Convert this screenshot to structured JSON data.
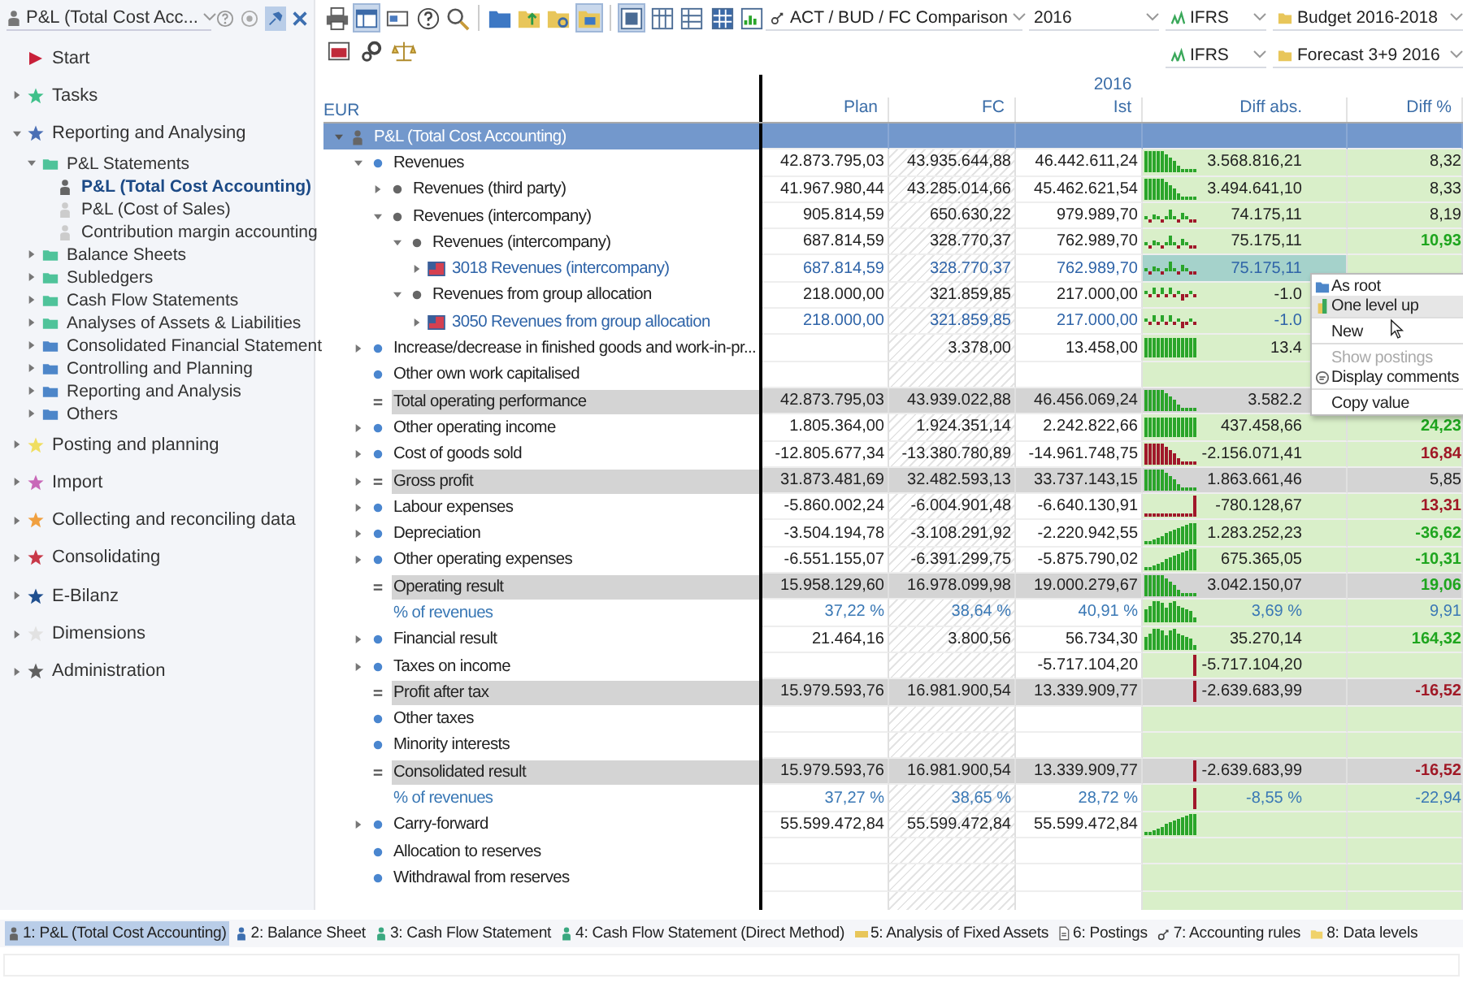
{
  "sidebar": {
    "selector": {
      "value": "P&L (Total Cost Acc..."
    },
    "header_buttons": [
      {
        "kind": "help",
        "selected": false
      },
      {
        "kind": "eye",
        "selected": false
      },
      {
        "kind": "pin",
        "selected": true
      },
      {
        "kind": "close",
        "selected": false
      }
    ],
    "items": [
      {
        "label": "Start",
        "kind": "start",
        "color": "#c8203a"
      },
      {
        "label": "Tasks",
        "kind": "group",
        "color": "#3fc08a",
        "expanded": false
      },
      {
        "label": "Reporting and Analysing",
        "kind": "group",
        "color": "#4a6fb5",
        "expanded": true,
        "children": [
          {
            "label": "P&L Statements",
            "kind": "folder",
            "color": "#4fc39a",
            "expanded": true,
            "children": [
              {
                "label": "P&L (Total Cost Accounting)",
                "kind": "report",
                "selected": true
              },
              {
                "label": "P&L (Cost of Sales)",
                "kind": "report",
                "selected": false
              },
              {
                "label": "Contribution margin accounting",
                "kind": "report",
                "selected": false
              }
            ]
          },
          {
            "label": "Balance Sheets",
            "kind": "folder",
            "color": "#4fc39a",
            "expanded": false
          },
          {
            "label": "Subledgers",
            "kind": "folder",
            "color": "#4fc39a",
            "expanded": false
          },
          {
            "label": "Cash Flow Statements",
            "kind": "folder",
            "color": "#4fc39a",
            "expanded": false
          },
          {
            "label": "Analyses of Assets & Liabilities",
            "kind": "folder",
            "color": "#4fc39a",
            "expanded": false
          },
          {
            "label": "Consolidated Financial Statement",
            "kind": "folder",
            "color": "#4d86c9",
            "expanded": false
          },
          {
            "label": "Controlling and Planning",
            "kind": "folder",
            "color": "#4d86c9",
            "expanded": false
          },
          {
            "label": "Reporting and Analysis",
            "kind": "folder",
            "color": "#4d86c9",
            "expanded": false
          },
          {
            "label": "Others",
            "kind": "folder",
            "color": "#4d86c9",
            "expanded": false
          }
        ]
      },
      {
        "label": "Posting and planning",
        "kind": "group",
        "color": "#f0de60",
        "expanded": false
      },
      {
        "label": "Import",
        "kind": "group",
        "color": "#c868b8",
        "expanded": false
      },
      {
        "label": "Collecting and reconciling data",
        "kind": "group",
        "color": "#f0a040",
        "expanded": false
      },
      {
        "label": "Consolidating",
        "kind": "group",
        "color": "#c83848",
        "expanded": false
      },
      {
        "label": "E-Bilanz",
        "kind": "group",
        "color": "#1f4f8f",
        "expanded": false
      },
      {
        "label": "Dimensions",
        "kind": "group",
        "color": "#e2e2e2",
        "expanded": false
      },
      {
        "label": "Administration",
        "kind": "group",
        "color": "#606060",
        "expanded": false
      }
    ]
  },
  "toolbar": {
    "row_1": [
      {
        "kind": "print",
        "selected": false
      },
      {
        "kind": "layout",
        "selected": true
      },
      {
        "kind": "card",
        "selected": false
      },
      {
        "kind": "help",
        "selected": false
      },
      {
        "kind": "search",
        "selected": false
      },
      {
        "kind": "separator"
      },
      {
        "kind": "folder-open",
        "selected": false
      },
      {
        "kind": "folder-up",
        "selected": false
      },
      {
        "kind": "folder-gear",
        "selected": false
      },
      {
        "kind": "folder-view",
        "selected": true
      },
      {
        "kind": "separator"
      },
      {
        "kind": "view-frame",
        "selected": true
      },
      {
        "kind": "view-columns",
        "selected": false
      },
      {
        "kind": "view-rows",
        "selected": false
      },
      {
        "kind": "view-grid",
        "selected": false
      },
      {
        "kind": "view-chart",
        "selected": false
      }
    ],
    "row_2": [
      {
        "kind": "window",
        "selected": false
      },
      {
        "kind": "gears",
        "selected": false
      },
      {
        "kind": "scale",
        "selected": false
      }
    ],
    "selectors_row_1": [
      {
        "kind": "link",
        "value": "ACT / BUD / FC Comparison"
      },
      {
        "kind": "plain",
        "value": "2016"
      },
      {
        "kind": "tree",
        "value": "IFRS"
      },
      {
        "kind": "folder",
        "value": "Budget 2016-2018"
      }
    ],
    "selectors_row_2": [
      {
        "kind": "tree",
        "value": "IFRS"
      },
      {
        "kind": "folder",
        "value": "Forecast 3+9 2016"
      }
    ]
  },
  "table": {
    "group_header": "2016",
    "corner": "EUR",
    "columns": [
      "Plan",
      "FC",
      "Ist",
      "Diff abs.",
      "Diff %"
    ],
    "rows": [
      {
        "kind": "root",
        "label": "P&L (Total Cost Accounting)",
        "expanded": true,
        "selected": false,
        "children": [
          {
            "kind": "item",
            "label": "Revenues",
            "expanded": true,
            "selected": false,
            "plan": "42.873.795,03",
            "fc": "43.935.644,88",
            "ist": "46.442.611,24",
            "diff_abs": "3.568.816,21",
            "diff_pct": {
              "value": "8,32"
            },
            "sparkline": {
              "kind": "falling",
              "color": "#2aa52a"
            },
            "children": [
              {
                "kind": "item",
                "label": "Revenues (third party)",
                "expanded": false,
                "selected": false,
                "plan": "41.967.980,44",
                "fc": "43.285.014,66",
                "ist": "45.462.621,54",
                "diff_abs": "3.494.641,10",
                "diff_pct": {
                  "value": "8,33"
                },
                "sparkline": {
                  "kind": "falling",
                  "color": "#2aa52a"
                }
              },
              {
                "kind": "item",
                "label": "Revenues (intercompany)",
                "expanded": true,
                "selected": false,
                "plan": "905.814,59",
                "fc": "650.630,22",
                "ist": "979.989,70",
                "diff_abs": "74.175,11",
                "diff_pct": {
                  "value": "8,19"
                },
                "sparkline": {
                  "kind": "mixed",
                  "color": "#2aa52a"
                },
                "children": [
                  {
                    "kind": "item",
                    "label": "Revenues (intercompany)",
                    "expanded": true,
                    "selected": false,
                    "plan": "687.814,59",
                    "fc": "328.770,37",
                    "ist": "762.989,70",
                    "diff_abs": "75.175,11",
                    "diff_pct": {
                      "value": "10,93",
                      "color": "#1ea51e"
                    },
                    "sparkline": {
                      "kind": "mixed",
                      "color": "#2aa52a"
                    },
                    "children": [
                      {
                        "kind": "account",
                        "label": "3018 Revenues (intercompany)",
                        "expanded": false,
                        "selected": true,
                        "plan": "687.814,59",
                        "fc": "328.770,37",
                        "ist": "762.989,70",
                        "diff_abs": "75.175,11",
                        "sparkline": {
                          "kind": "mixed",
                          "color": "#2aa52a"
                        }
                      }
                    ]
                  },
                  {
                    "kind": "item",
                    "label": "Revenues from group allocation",
                    "expanded": true,
                    "selected": false,
                    "plan": "218.000,00",
                    "fc": "321.859,85",
                    "ist": "217.000,00",
                    "diff_abs": "-1.0",
                    "sparkline": {
                      "kind": "dips",
                      "color": "#2aa52a"
                    },
                    "children": [
                      {
                        "kind": "account",
                        "label": "3050 Revenues from group allocation",
                        "expanded": false,
                        "selected": false,
                        "plan": "218.000,00",
                        "fc": "321.859,85",
                        "ist": "217.000,00",
                        "diff_abs": "-1.0",
                        "sparkline": {
                          "kind": "dips",
                          "color": "#2aa52a"
                        }
                      }
                    ]
                  }
                ]
              }
            ]
          },
          {
            "kind": "item",
            "label": "Increase/decrease in finished goods and work-in-pr...",
            "expanded": false,
            "selected": false,
            "fc": "3.378,00",
            "ist": "13.458,00",
            "diff_abs": "13.4",
            "sparkline": {
              "kind": "full",
              "color": "#2aa52a"
            }
          },
          {
            "kind": "item",
            "label": "Other own work capitalised",
            "selected": false
          },
          {
            "kind": "sum",
            "label": "Total operating performance",
            "selected": false,
            "plan": "42.873.795,03",
            "fc": "43.939.022,88",
            "ist": "46.456.069,24",
            "diff_abs": "3.582.2",
            "sparkline": {
              "kind": "falling",
              "color": "#2aa52a"
            }
          },
          {
            "kind": "item",
            "label": "Other operating income",
            "expanded": false,
            "selected": false,
            "plan": "1.805.364,00",
            "fc": "1.924.351,14",
            "ist": "2.242.822,66",
            "diff_abs": "437.458,66",
            "diff_pct": {
              "value": "24,23",
              "color": "#1ea51e"
            },
            "sparkline": {
              "kind": "full",
              "color": "#2aa52a"
            }
          },
          {
            "kind": "item",
            "label": "Cost of goods sold",
            "expanded": false,
            "selected": false,
            "plan": "-12.805.677,34",
            "fc": "-13.380.780,89",
            "ist": "-14.961.748,75",
            "diff_abs": "-2.156.071,41",
            "diff_pct": {
              "value": "16,84",
              "color": "#a01826"
            },
            "sparkline": {
              "kind": "falling",
              "color": "#a0182a"
            }
          },
          {
            "kind": "sum",
            "label": "Gross profit",
            "expanded": false,
            "selected": false,
            "plan": "31.873.481,69",
            "fc": "32.482.593,13",
            "ist": "33.737.143,15",
            "diff_abs": "1.863.661,46",
            "diff_pct": {
              "value": "5,85"
            },
            "sparkline": {
              "kind": "falling",
              "color": "#2aa52a"
            }
          },
          {
            "kind": "item",
            "label": "Labour expenses",
            "expanded": false,
            "selected": false,
            "plan": "-5.860.002,24",
            "fc": "-6.004.901,48",
            "ist": "-6.640.130,91",
            "diff_abs": "-780.128,67",
            "diff_pct": {
              "value": "13,31",
              "color": "#a01826"
            },
            "sparkline": {
              "kind": "spike",
              "color": "#a0182a"
            }
          },
          {
            "kind": "item",
            "label": "Depreciation",
            "expanded": false,
            "selected": false,
            "plan": "-3.504.194,78",
            "fc": "-3.108.291,92",
            "ist": "-2.220.942,55",
            "diff_abs": "1.283.252,23",
            "diff_pct": {
              "value": "-36,62",
              "color": "#1ea51e"
            },
            "sparkline": {
              "kind": "rising",
              "color": "#2aa52a"
            }
          },
          {
            "kind": "item",
            "label": "Other operating expenses",
            "expanded": false,
            "selected": false,
            "plan": "-6.551.155,07",
            "fc": "-6.391.299,75",
            "ist": "-5.875.790,02",
            "diff_abs": "675.365,05",
            "diff_pct": {
              "value": "-10,31",
              "color": "#1ea51e"
            },
            "sparkline": {
              "kind": "rising",
              "color": "#2aa52a"
            }
          },
          {
            "kind": "sum",
            "label": "Operating result",
            "selected": false,
            "plan": "15.958.129,60",
            "fc": "16.978.099,98",
            "ist": "19.000.279,67",
            "diff_abs": "3.042.150,07",
            "diff_pct": {
              "value": "19,06",
              "color": "#1ea51e"
            },
            "sparkline": {
              "kind": "falling",
              "color": "#2aa52a"
            }
          },
          {
            "kind": "percent",
            "label": "% of revenues",
            "selected": false,
            "plan": "37,22 %",
            "fc": "38,64 %",
            "ist": "40,91 %",
            "diff_abs": "3,69 %",
            "diff_pct": {
              "value": "9,91"
            },
            "sparkline": {
              "kind": "hump",
              "color": "#2aa52a"
            }
          },
          {
            "kind": "item",
            "label": "Financial result",
            "expanded": false,
            "selected": false,
            "plan": "21.464,16",
            "fc": "3.800,56",
            "ist": "56.734,30",
            "diff_abs": "35.270,14",
            "diff_pct": {
              "value": "164,32",
              "color": "#1ea51e"
            },
            "sparkline": {
              "kind": "hump",
              "color": "#2aa52a"
            }
          },
          {
            "kind": "item",
            "label": "Taxes on income",
            "expanded": false,
            "selected": false,
            "ist": "-5.717.104,20",
            "diff_abs": "-5.717.104,20",
            "sparkline": {
              "kind": "single",
              "color": "#a0182a"
            }
          },
          {
            "kind": "sum",
            "label": "Profit after tax",
            "selected": false,
            "plan": "15.979.593,76",
            "fc": "16.981.900,54",
            "ist": "13.339.909,77",
            "diff_abs": "-2.639.683,99",
            "diff_pct": {
              "value": "-16,52",
              "color": "#a01826"
            },
            "sparkline": {
              "kind": "single",
              "color": "#a0182a"
            }
          },
          {
            "kind": "item",
            "label": "Other taxes",
            "selected": false
          },
          {
            "kind": "item",
            "label": "Minority interests",
            "selected": false
          },
          {
            "kind": "sum",
            "label": "Consolidated result",
            "selected": false,
            "plan": "15.979.593,76",
            "fc": "16.981.900,54",
            "ist": "13.339.909,77",
            "diff_abs": "-2.639.683,99",
            "diff_pct": {
              "value": "-16,52",
              "color": "#a01826"
            },
            "sparkline": {
              "kind": "single",
              "color": "#a0182a"
            }
          },
          {
            "kind": "percent",
            "label": "% of revenues",
            "selected": false,
            "plan": "37,27 %",
            "fc": "38,65 %",
            "ist": "28,72 %",
            "diff_abs": "-8,55 %",
            "diff_pct": {
              "value": "-22,94"
            },
            "sparkline": {
              "kind": "single",
              "color": "#a0182a"
            }
          },
          {
            "kind": "item",
            "label": "Carry-forward",
            "expanded": false,
            "selected": false,
            "plan": "55.599.472,84",
            "fc": "55.599.472,84",
            "ist": "55.599.472,84",
            "sparkline": {
              "kind": "rising",
              "color": "#2aa52a"
            }
          },
          {
            "kind": "item",
            "label": "Allocation to reserves",
            "selected": false
          },
          {
            "kind": "item",
            "label": "Withdrawal from reserves",
            "selected": false
          }
        ]
      }
    ]
  },
  "context_menu": {
    "items": [
      {
        "label": "As root",
        "kind": "root",
        "highlighted": false,
        "disabled": false,
        "separator_after": false
      },
      {
        "label": "One level up",
        "kind": "up",
        "highlighted": true,
        "disabled": false,
        "separator_after": true
      },
      {
        "label": "New",
        "kind": "plain",
        "highlighted": false,
        "disabled": false,
        "separator_after": true
      },
      {
        "label": "Show postings",
        "kind": "plain",
        "highlighted": false,
        "disabled": true,
        "separator_after": false
      },
      {
        "label": "Display comments",
        "kind": "comment",
        "highlighted": false,
        "disabled": false,
        "separator_after": true
      },
      {
        "label": "Copy value",
        "kind": "plain",
        "highlighted": false,
        "disabled": false,
        "separator_after": false
      }
    ]
  },
  "bottom_tabs": [
    {
      "label": "1: P&L (Total Cost Accounting)",
      "kind": "report",
      "color": "#666666",
      "selected": true
    },
    {
      "label": "2: Balance Sheet",
      "kind": "report",
      "color": "#3d6fb0",
      "selected": false
    },
    {
      "label": "3: Cash Flow Statement",
      "kind": "report",
      "color": "#3aa880",
      "selected": false
    },
    {
      "label": "4: Cash Flow Statement (Direct Method)",
      "kind": "report",
      "color": "#3aa880",
      "selected": false
    },
    {
      "label": "5: Analysis of Fixed Assets",
      "kind": "assets",
      "selected": false
    },
    {
      "label": "6: Postings",
      "kind": "document",
      "selected": false
    },
    {
      "label": "7: Accounting rules",
      "kind": "link",
      "selected": false
    },
    {
      "label": "8: Data levels",
      "kind": "folder",
      "selected": false
    }
  ]
}
